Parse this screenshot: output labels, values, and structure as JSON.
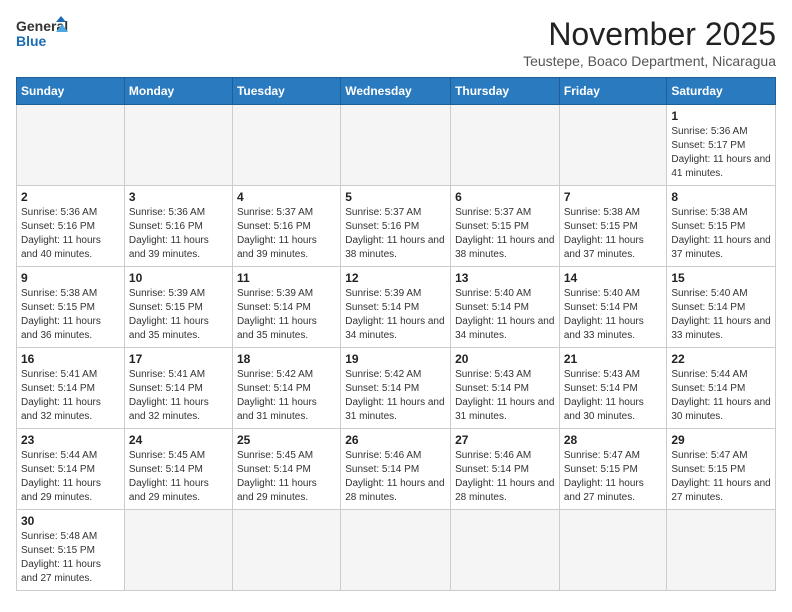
{
  "header": {
    "logo_line1": "General",
    "logo_line2": "Blue",
    "month_title": "November 2025",
    "location": "Teustepe, Boaco Department, Nicaragua"
  },
  "weekdays": [
    "Sunday",
    "Monday",
    "Tuesday",
    "Wednesday",
    "Thursday",
    "Friday",
    "Saturday"
  ],
  "days": [
    {
      "date": "",
      "sunrise": "",
      "sunset": "",
      "daylight": ""
    },
    {
      "date": "",
      "sunrise": "",
      "sunset": "",
      "daylight": ""
    },
    {
      "date": "",
      "sunrise": "",
      "sunset": "",
      "daylight": ""
    },
    {
      "date": "",
      "sunrise": "",
      "sunset": "",
      "daylight": ""
    },
    {
      "date": "",
      "sunrise": "",
      "sunset": "",
      "daylight": ""
    },
    {
      "date": "",
      "sunrise": "",
      "sunset": "",
      "daylight": ""
    },
    {
      "date": "1",
      "sunrise": "5:36 AM",
      "sunset": "5:17 PM",
      "daylight": "11 hours and 41 minutes."
    },
    {
      "date": "2",
      "sunrise": "5:36 AM",
      "sunset": "5:16 PM",
      "daylight": "11 hours and 40 minutes."
    },
    {
      "date": "3",
      "sunrise": "5:36 AM",
      "sunset": "5:16 PM",
      "daylight": "11 hours and 39 minutes."
    },
    {
      "date": "4",
      "sunrise": "5:37 AM",
      "sunset": "5:16 PM",
      "daylight": "11 hours and 39 minutes."
    },
    {
      "date": "5",
      "sunrise": "5:37 AM",
      "sunset": "5:16 PM",
      "daylight": "11 hours and 38 minutes."
    },
    {
      "date": "6",
      "sunrise": "5:37 AM",
      "sunset": "5:15 PM",
      "daylight": "11 hours and 38 minutes."
    },
    {
      "date": "7",
      "sunrise": "5:38 AM",
      "sunset": "5:15 PM",
      "daylight": "11 hours and 37 minutes."
    },
    {
      "date": "8",
      "sunrise": "5:38 AM",
      "sunset": "5:15 PM",
      "daylight": "11 hours and 37 minutes."
    },
    {
      "date": "9",
      "sunrise": "5:38 AM",
      "sunset": "5:15 PM",
      "daylight": "11 hours and 36 minutes."
    },
    {
      "date": "10",
      "sunrise": "5:39 AM",
      "sunset": "5:15 PM",
      "daylight": "11 hours and 35 minutes."
    },
    {
      "date": "11",
      "sunrise": "5:39 AM",
      "sunset": "5:14 PM",
      "daylight": "11 hours and 35 minutes."
    },
    {
      "date": "12",
      "sunrise": "5:39 AM",
      "sunset": "5:14 PM",
      "daylight": "11 hours and 34 minutes."
    },
    {
      "date": "13",
      "sunrise": "5:40 AM",
      "sunset": "5:14 PM",
      "daylight": "11 hours and 34 minutes."
    },
    {
      "date": "14",
      "sunrise": "5:40 AM",
      "sunset": "5:14 PM",
      "daylight": "11 hours and 33 minutes."
    },
    {
      "date": "15",
      "sunrise": "5:40 AM",
      "sunset": "5:14 PM",
      "daylight": "11 hours and 33 minutes."
    },
    {
      "date": "16",
      "sunrise": "5:41 AM",
      "sunset": "5:14 PM",
      "daylight": "11 hours and 32 minutes."
    },
    {
      "date": "17",
      "sunrise": "5:41 AM",
      "sunset": "5:14 PM",
      "daylight": "11 hours and 32 minutes."
    },
    {
      "date": "18",
      "sunrise": "5:42 AM",
      "sunset": "5:14 PM",
      "daylight": "11 hours and 31 minutes."
    },
    {
      "date": "19",
      "sunrise": "5:42 AM",
      "sunset": "5:14 PM",
      "daylight": "11 hours and 31 minutes."
    },
    {
      "date": "20",
      "sunrise": "5:43 AM",
      "sunset": "5:14 PM",
      "daylight": "11 hours and 31 minutes."
    },
    {
      "date": "21",
      "sunrise": "5:43 AM",
      "sunset": "5:14 PM",
      "daylight": "11 hours and 30 minutes."
    },
    {
      "date": "22",
      "sunrise": "5:44 AM",
      "sunset": "5:14 PM",
      "daylight": "11 hours and 30 minutes."
    },
    {
      "date": "23",
      "sunrise": "5:44 AM",
      "sunset": "5:14 PM",
      "daylight": "11 hours and 29 minutes."
    },
    {
      "date": "24",
      "sunrise": "5:45 AM",
      "sunset": "5:14 PM",
      "daylight": "11 hours and 29 minutes."
    },
    {
      "date": "25",
      "sunrise": "5:45 AM",
      "sunset": "5:14 PM",
      "daylight": "11 hours and 29 minutes."
    },
    {
      "date": "26",
      "sunrise": "5:46 AM",
      "sunset": "5:14 PM",
      "daylight": "11 hours and 28 minutes."
    },
    {
      "date": "27",
      "sunrise": "5:46 AM",
      "sunset": "5:14 PM",
      "daylight": "11 hours and 28 minutes."
    },
    {
      "date": "28",
      "sunrise": "5:47 AM",
      "sunset": "5:15 PM",
      "daylight": "11 hours and 27 minutes."
    },
    {
      "date": "29",
      "sunrise": "5:47 AM",
      "sunset": "5:15 PM",
      "daylight": "11 hours and 27 minutes."
    },
    {
      "date": "30",
      "sunrise": "5:48 AM",
      "sunset": "5:15 PM",
      "daylight": "11 hours and 27 minutes."
    },
    {
      "date": "",
      "sunrise": "",
      "sunset": "",
      "daylight": ""
    },
    {
      "date": "",
      "sunrise": "",
      "sunset": "",
      "daylight": ""
    },
    {
      "date": "",
      "sunrise": "",
      "sunset": "",
      "daylight": ""
    },
    {
      "date": "",
      "sunrise": "",
      "sunset": "",
      "daylight": ""
    },
    {
      "date": "",
      "sunrise": "",
      "sunset": "",
      "daylight": ""
    }
  ],
  "labels": {
    "sunrise_prefix": "Sunrise: ",
    "sunset_prefix": "Sunset: ",
    "daylight_prefix": "Daylight: "
  }
}
